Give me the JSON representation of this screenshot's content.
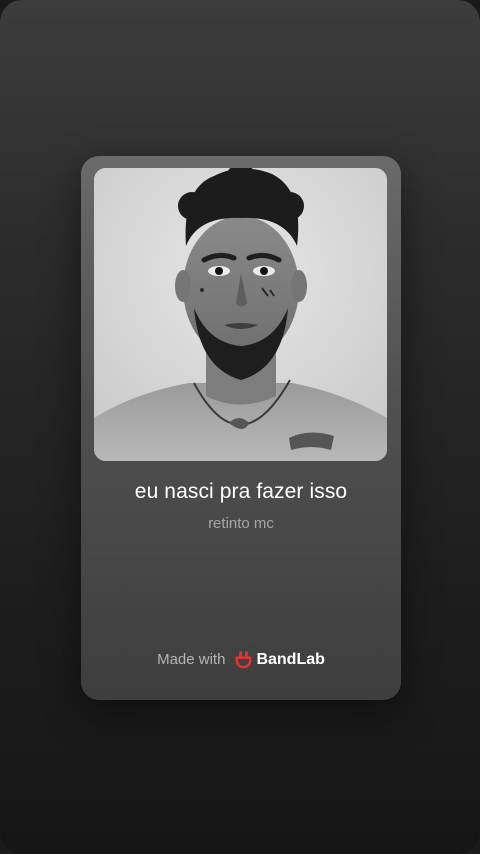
{
  "track": {
    "title": "eu nasci pra fazer isso",
    "artist": "retinto mc"
  },
  "footer": {
    "made_with_label": "Made with",
    "brand_name": "BandLab",
    "brand_color": "#e8322f"
  },
  "cover_art": {
    "subject": "portrait-photo"
  }
}
